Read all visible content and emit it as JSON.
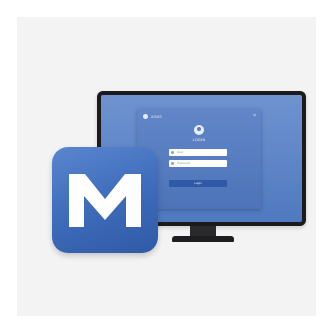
{
  "app_icon": {
    "name": "M-icon",
    "color": "#3d6ab9"
  },
  "login_window": {
    "title": "XDMS",
    "heading": "LOGIN",
    "username_placeholder": "User",
    "password_placeholder": "Password",
    "button_label": "Login",
    "close_glyph": "×"
  },
  "colors": {
    "background": "#f3f3f3",
    "screen": "#5b82c6",
    "monitor_frame": "#1b1b1d",
    "button": "#2f5aa6"
  }
}
